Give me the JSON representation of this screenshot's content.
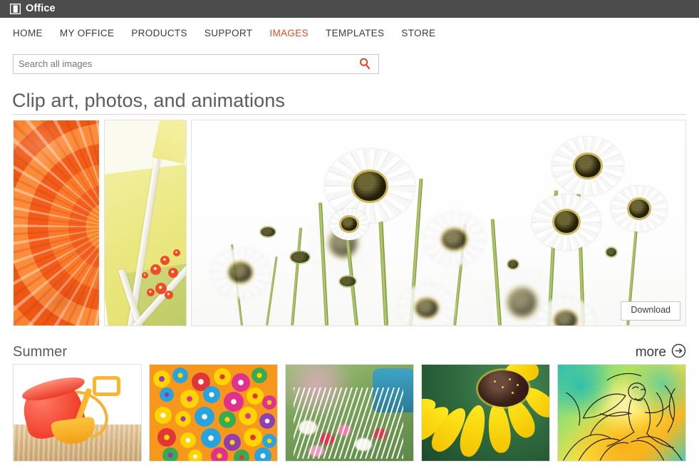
{
  "colors": {
    "suite_bar": "#4c4c4c",
    "accent_orange": "#e8491d",
    "search_icon": "#e23a14",
    "nav_text": "#3b3b47",
    "heading_text": "#5b5b63",
    "border": "#e2e2e2"
  },
  "suite": {
    "logo_icon": "office-logo-icon",
    "name": "Office"
  },
  "nav": {
    "items": [
      {
        "label": "HOME",
        "active": false
      },
      {
        "label": "MY OFFICE",
        "active": false
      },
      {
        "label": "PRODUCTS",
        "active": false
      },
      {
        "label": "SUPPORT",
        "active": false
      },
      {
        "label": "IMAGES",
        "active": true
      },
      {
        "label": "TEMPLATES",
        "active": false
      },
      {
        "label": "STORE",
        "active": false
      }
    ]
  },
  "search": {
    "value": "",
    "placeholder": "Search all images",
    "icon": "search-icon"
  },
  "page": {
    "title": "Clip art, photos, and animations"
  },
  "hero": {
    "tiles": [
      {
        "alt": "orange gerbera daisy petals close-up"
      },
      {
        "alt": "yellow paper craft with red glitter flowers"
      },
      {
        "alt": "white daisies against a white sky"
      }
    ],
    "download_label": "Download"
  },
  "sections": [
    {
      "title": "Summer",
      "more_label": "more",
      "more_icon": "arrow-right-circle-icon",
      "thumbnails": [
        {
          "alt": "red sand pail and yellow shovel on sand"
        },
        {
          "alt": "colorful flower pattern on orange background"
        },
        {
          "alt": "watering can sprinkling flowers"
        },
        {
          "alt": "yellow black-eyed susan flower"
        },
        {
          "alt": "watercolor fairy on a sunflower illustration"
        }
      ]
    }
  ]
}
